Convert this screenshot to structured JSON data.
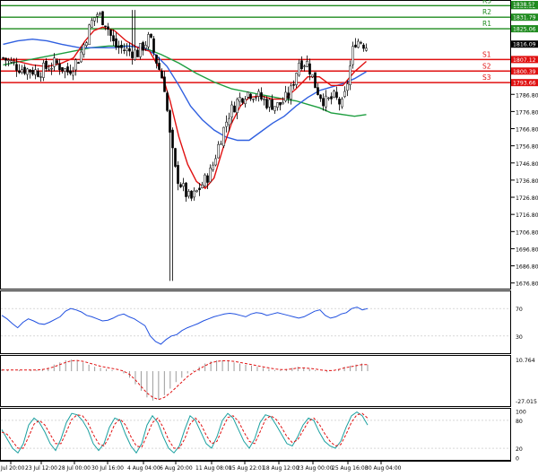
{
  "chart_data": [
    {
      "type": "candlestick",
      "y_ticks": [
        "1676.80",
        "1686.80",
        "1696.80",
        "1706.80",
        "1716.80",
        "1726.80",
        "1736.80",
        "1746.80",
        "1756.80",
        "1766.80",
        "1776.80",
        "1786.80"
      ],
      "ylim": [
        1673.5,
        1841.3
      ],
      "x_ticks": [
        "Jul 20:00",
        "23 Jul 12:00",
        "28 Jul 00:00",
        "30 Jul 16:00",
        "4 Aug 04:00",
        "6 Aug 20:00",
        "11 Aug 08:00",
        "15 Aug 22:01",
        "18 Aug 12:00",
        "23 Aug 00:00",
        "25 Aug 16:00",
        "30 Aug 04:00"
      ],
      "bar_count": 136,
      "levels": [
        {
          "label": "R3",
          "value": 1838.52,
          "value_text": "1838.52",
          "color": "#1f8b1f"
        },
        {
          "label": "R2",
          "value": 1831.79,
          "value_text": "1831.79",
          "color": "#1f8b1f"
        },
        {
          "label": "R1",
          "value": 1825.06,
          "value_text": "1825.06",
          "color": "#1f8b1f"
        },
        {
          "label": "S1",
          "value": 1807.12,
          "value_text": "1807.12",
          "color": "#e01010"
        },
        {
          "label": "S2",
          "value": 1800.39,
          "value_text": "1800.39",
          "color": "#e01010"
        },
        {
          "label": "S3",
          "value": 1793.66,
          "value_text": "1793.66",
          "color": "#e01010"
        }
      ],
      "current_price": 1816.09,
      "current_price_text": "1816.09",
      "top_tag_text": "1838.5?",
      "close_path": [
        [
          0,
          1808
        ],
        [
          6,
          1802
        ],
        [
          12,
          1800
        ],
        [
          18,
          1805
        ],
        [
          22,
          1800
        ],
        [
          26,
          1808
        ],
        [
          30,
          1828
        ],
        [
          32,
          1834
        ],
        [
          35,
          1829
        ],
        [
          38,
          1815
        ],
        [
          43,
          1812
        ],
        [
          46,
          1811
        ],
        [
          50,
          1820
        ],
        [
          52,
          1808
        ],
        [
          55,
          1793
        ],
        [
          57,
          1762
        ],
        [
          59,
          1740
        ],
        [
          62,
          1730
        ],
        [
          64,
          1725
        ],
        [
          67,
          1732
        ],
        [
          71,
          1742
        ],
        [
          74,
          1760
        ],
        [
          77,
          1775
        ],
        [
          80,
          1783
        ],
        [
          83,
          1788
        ],
        [
          86,
          1787
        ],
        [
          90,
          1782
        ],
        [
          94,
          1780
        ],
        [
          98,
          1787
        ],
        [
          101,
          1806
        ],
        [
          104,
          1805
        ],
        [
          107,
          1790
        ],
        [
          110,
          1782
        ],
        [
          113,
          1785
        ],
        [
          116,
          1780
        ],
        [
          118,
          1798
        ],
        [
          120,
          1818
        ],
        [
          122,
          1818
        ],
        [
          124,
          1815
        ]
      ],
      "ma_red": [
        [
          0,
          1808
        ],
        [
          5,
          1806
        ],
        [
          10,
          1804
        ],
        [
          15,
          1803
        ],
        [
          20,
          1805
        ],
        [
          24,
          1808
        ],
        [
          28,
          1818
        ],
        [
          31,
          1824
        ],
        [
          34,
          1826
        ],
        [
          38,
          1824
        ],
        [
          42,
          1818
        ],
        [
          46,
          1814
        ],
        [
          50,
          1812
        ],
        [
          54,
          1800
        ],
        [
          57,
          1783
        ],
        [
          60,
          1762
        ],
        [
          63,
          1746
        ],
        [
          66,
          1736
        ],
        [
          69,
          1732
        ],
        [
          72,
          1738
        ],
        [
          75,
          1755
        ],
        [
          78,
          1770
        ],
        [
          81,
          1780
        ],
        [
          84,
          1785
        ],
        [
          88,
          1786
        ],
        [
          92,
          1784
        ],
        [
          96,
          1784
        ],
        [
          100,
          1790
        ],
        [
          104,
          1797
        ],
        [
          108,
          1797
        ],
        [
          112,
          1792
        ],
        [
          116,
          1792
        ],
        [
          120,
          1800
        ],
        [
          124,
          1806
        ]
      ],
      "ma_blue": [
        [
          0,
          1816
        ],
        [
          5,
          1818
        ],
        [
          10,
          1819
        ],
        [
          15,
          1818
        ],
        [
          20,
          1816
        ],
        [
          26,
          1814
        ],
        [
          32,
          1814
        ],
        [
          38,
          1814
        ],
        [
          43,
          1815
        ],
        [
          48,
          1814
        ],
        [
          52,
          1810
        ],
        [
          56,
          1803
        ],
        [
          60,
          1792
        ],
        [
          64,
          1780
        ],
        [
          68,
          1772
        ],
        [
          72,
          1766
        ],
        [
          76,
          1762
        ],
        [
          80,
          1760
        ],
        [
          84,
          1760
        ],
        [
          88,
          1765
        ],
        [
          92,
          1770
        ],
        [
          96,
          1774
        ],
        [
          100,
          1780
        ],
        [
          104,
          1785
        ],
        [
          108,
          1789
        ],
        [
          112,
          1791
        ],
        [
          116,
          1793
        ],
        [
          120,
          1796
        ],
        [
          124,
          1800
        ]
      ],
      "ma_green": [
        [
          0,
          1804
        ],
        [
          6,
          1806
        ],
        [
          12,
          1808
        ],
        [
          18,
          1810
        ],
        [
          24,
          1812
        ],
        [
          30,
          1814
        ],
        [
          36,
          1815
        ],
        [
          42,
          1815
        ],
        [
          48,
          1814
        ],
        [
          54,
          1810
        ],
        [
          60,
          1805
        ],
        [
          66,
          1799
        ],
        [
          72,
          1794
        ],
        [
          78,
          1790
        ],
        [
          84,
          1788
        ],
        [
          90,
          1786
        ],
        [
          96,
          1784
        ],
        [
          100,
          1783
        ],
        [
          104,
          1781
        ],
        [
          108,
          1779
        ],
        [
          112,
          1776
        ],
        [
          116,
          1775
        ],
        [
          120,
          1774
        ],
        [
          124,
          1775
        ]
      ],
      "line_colors": {
        "red": "#e01010",
        "blue": "#3060e0",
        "green": "#1e9e40",
        "price": "#000000"
      }
    },
    {
      "type": "line",
      "y_ticks": [
        "70",
        "30"
      ],
      "ylim": [
        5,
        95
      ],
      "color": "#2050e0",
      "values": [
        60,
        55,
        48,
        42,
        50,
        55,
        52,
        48,
        47,
        50,
        54,
        58,
        66,
        70,
        68,
        65,
        60,
        58,
        55,
        52,
        53,
        56,
        60,
        62,
        58,
        55,
        50,
        45,
        30,
        22,
        18,
        25,
        30,
        32,
        38,
        42,
        45,
        48,
        52,
        55,
        58,
        60,
        62,
        63,
        62,
        60,
        58,
        62,
        64,
        63,
        60,
        62,
        64,
        62,
        60,
        58,
        56,
        58,
        62,
        66,
        68,
        60,
        56,
        58,
        62,
        64,
        70,
        72,
        68,
        70
      ]
    },
    {
      "type": "bar",
      "y_ticks": [
        "10.764",
        "-27.015"
      ],
      "ylim": [
        -32,
        14
      ],
      "bar_color": "#9a9a9a",
      "signal_color": "#e01010",
      "values": [
        2,
        1,
        0,
        1,
        0,
        1,
        1,
        2,
        3,
        6,
        8,
        10,
        10.7,
        10,
        8,
        6,
        4,
        3,
        2,
        1,
        0,
        -2,
        -6,
        -12,
        -18,
        -24,
        -27,
        -26,
        -22,
        -16,
        -10,
        -6,
        -2,
        1,
        4,
        7,
        9,
        10,
        10,
        9,
        8,
        7,
        6,
        5,
        4,
        3,
        2,
        1,
        1,
        2,
        3,
        4,
        3,
        2,
        1,
        0,
        -1,
        0,
        2,
        4,
        5,
        6,
        7,
        6
      ],
      "signal": [
        1,
        1,
        1,
        1,
        1,
        1,
        1,
        1.5,
        2.5,
        4,
        6,
        8,
        9.5,
        9.8,
        9,
        7.5,
        6,
        4.5,
        3.5,
        2.5,
        1.5,
        0,
        -3,
        -8,
        -14,
        -20,
        -24,
        -26,
        -24,
        -20,
        -15,
        -10,
        -5,
        -1,
        2,
        5,
        7.5,
        9,
        9.5,
        9.5,
        9,
        8,
        7,
        6,
        5,
        4,
        3,
        2,
        1.5,
        1.5,
        2,
        3,
        3,
        2.5,
        2,
        1,
        0.5,
        0.5,
        1.5,
        3,
        4,
        5,
        6,
        6
      ]
    },
    {
      "type": "line",
      "y_ticks": [
        "100",
        "80",
        "20",
        "0"
      ],
      "ylim": [
        -5,
        105
      ],
      "series": [
        {
          "color": "#1aa0a0",
          "values": [
            60,
            40,
            20,
            10,
            30,
            70,
            85,
            75,
            55,
            30,
            15,
            40,
            75,
            95,
            92,
            80,
            60,
            30,
            15,
            30,
            65,
            85,
            80,
            50,
            25,
            10,
            30,
            70,
            90,
            75,
            45,
            20,
            10,
            25,
            60,
            90,
            80,
            55,
            30,
            20,
            45,
            80,
            95,
            85,
            60,
            35,
            20,
            40,
            75,
            92,
            88,
            70,
            50,
            30,
            25,
            45,
            70,
            85,
            80,
            55,
            35,
            25,
            20,
            35,
            65,
            90,
            98,
            90,
            70
          ]
        },
        {
          "color": "#e01010",
          "dash": "3,2",
          "values": [
            55,
            50,
            35,
            20,
            20,
            45,
            72,
            80,
            70,
            50,
            30,
            30,
            55,
            82,
            92,
            90,
            75,
            50,
            30,
            25,
            45,
            72,
            83,
            70,
            45,
            25,
            22,
            48,
            75,
            85,
            65,
            38,
            20,
            20,
            40,
            72,
            85,
            72,
            48,
            30,
            35,
            62,
            86,
            90,
            78,
            55,
            35,
            30,
            55,
            82,
            90,
            82,
            65,
            45,
            32,
            38,
            58,
            78,
            85,
            72,
            52,
            35,
            25,
            28,
            50,
            76,
            92,
            95,
            85
          ]
        }
      ]
    }
  ]
}
